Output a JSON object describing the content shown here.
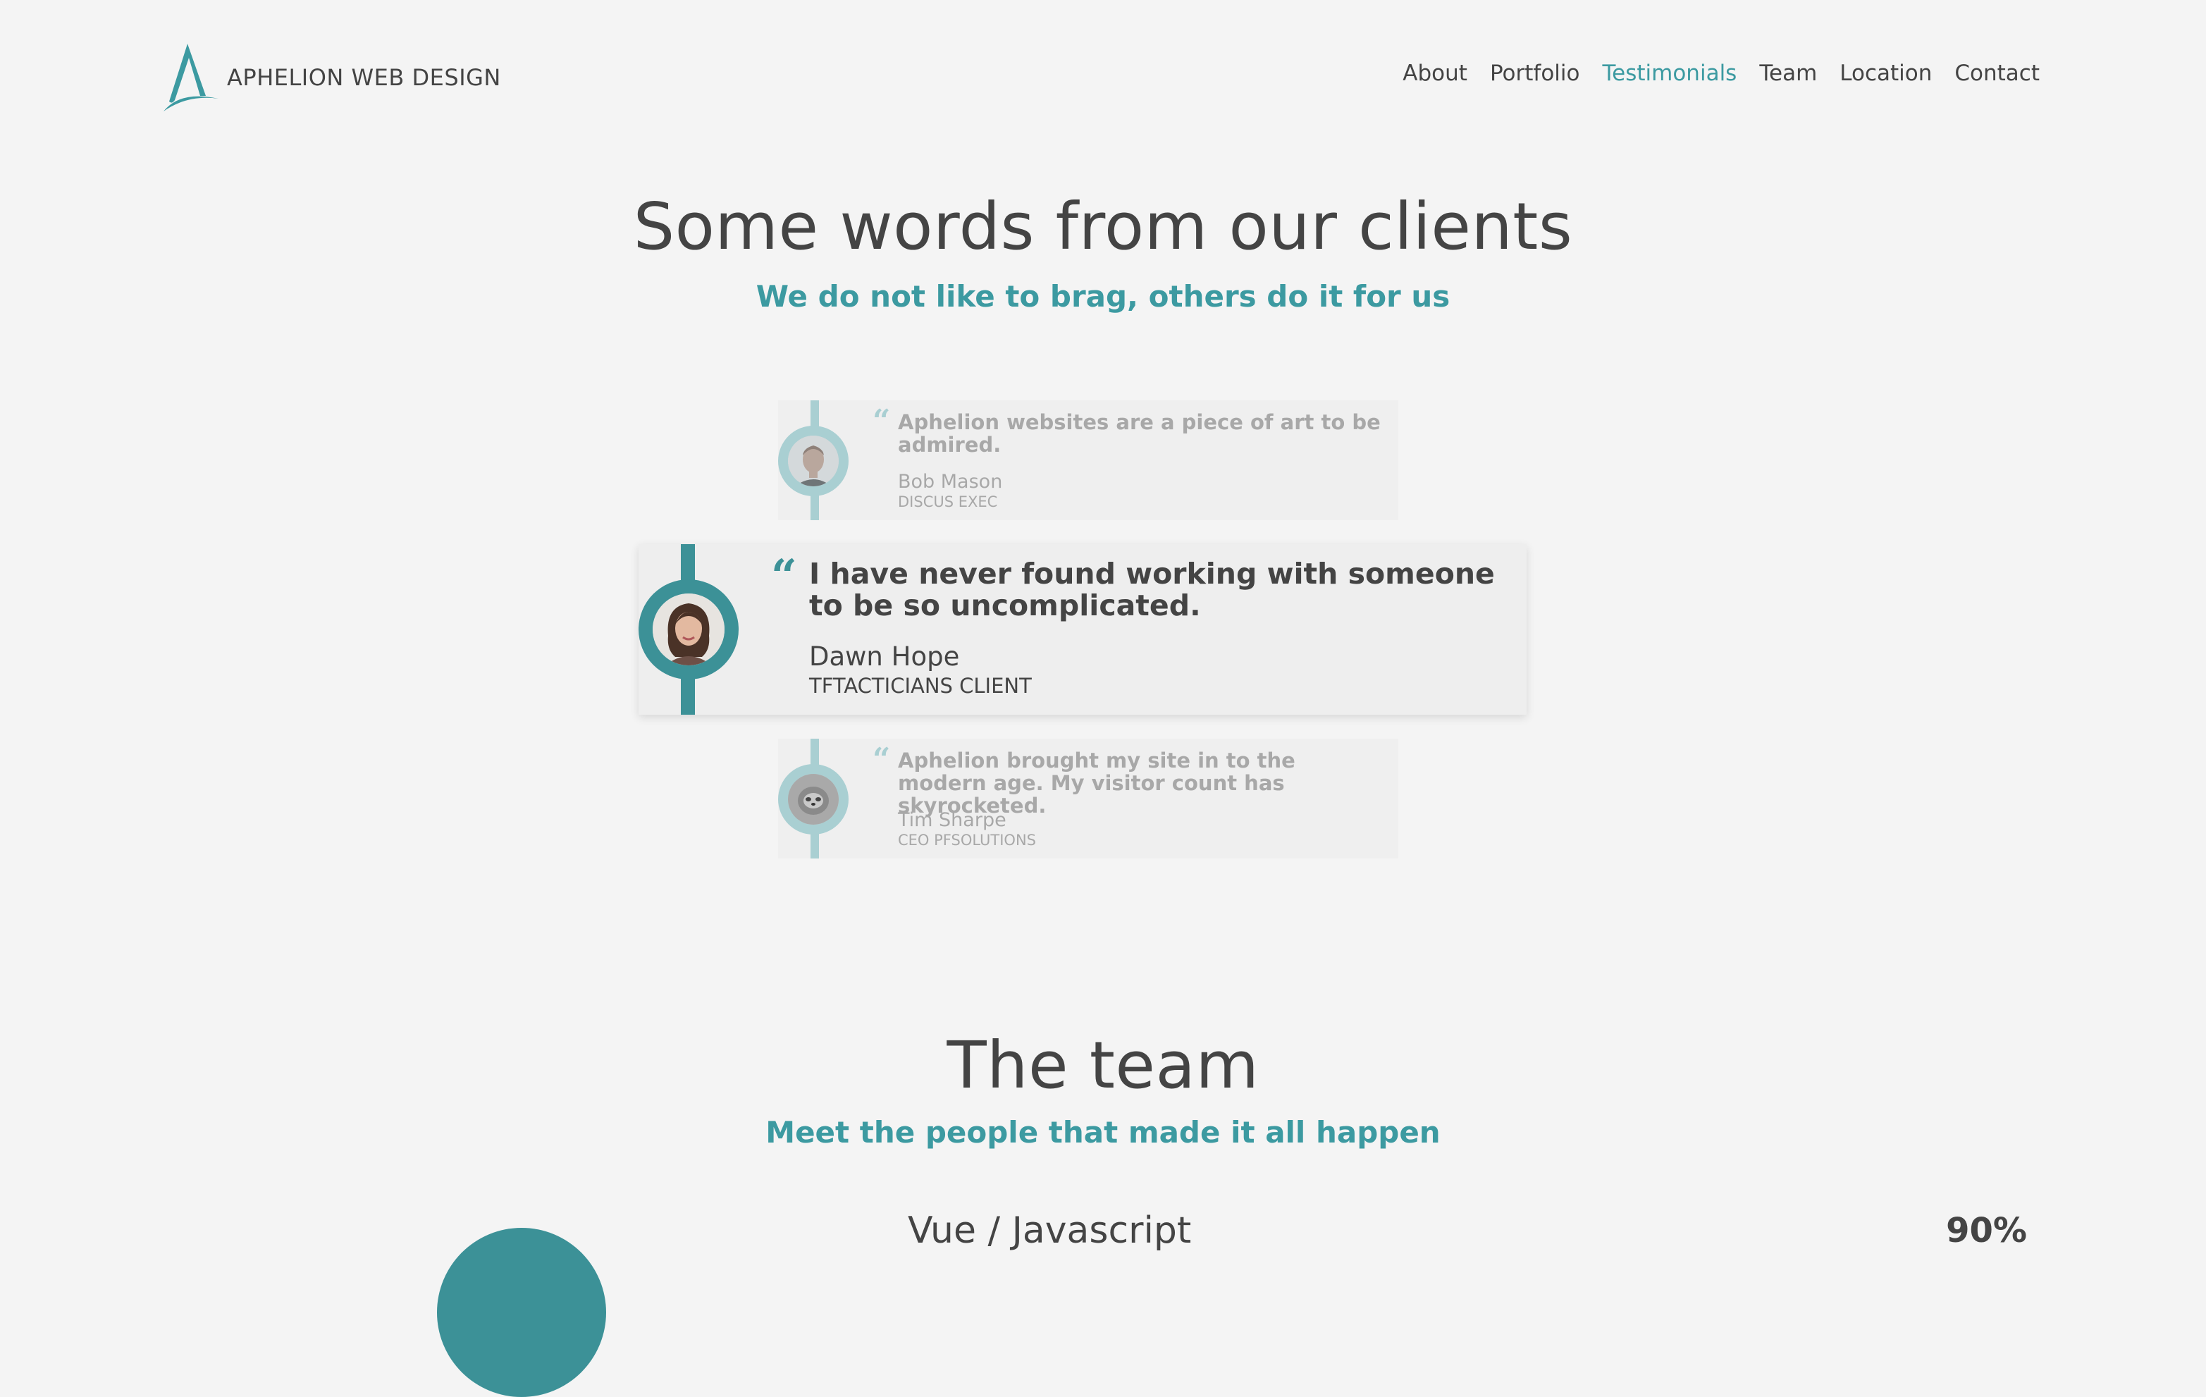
{
  "header": {
    "brand": "APHELION WEB DESIGN",
    "nav": [
      {
        "label": "About",
        "active": false
      },
      {
        "label": "Portfolio",
        "active": false
      },
      {
        "label": "Testimonials",
        "active": true
      },
      {
        "label": "Team",
        "active": false
      },
      {
        "label": "Location",
        "active": false
      },
      {
        "label": "Contact",
        "active": false
      }
    ]
  },
  "testimonials": {
    "title": "Some words from our clients",
    "subtitle": "We do not like to brag, others do it for us",
    "items": [
      {
        "quote": "Aphelion websites are a piece of art to be admired.",
        "author": "Bob Mason",
        "role": "DISCUS EXEC",
        "featured": false
      },
      {
        "quote": "I have never found working with someone to be so uncomplicated.",
        "author": "Dawn Hope",
        "role": "TFTACTICIANS CLIENT",
        "featured": true
      },
      {
        "quote": "Aphelion brought my site in to the modern age. My visitor count has skyrocketed.",
        "author": "Tim Sharpe",
        "role": "CEO PFSOLUTIONS",
        "featured": false
      }
    ],
    "quote_mark": "“"
  },
  "team": {
    "title": "The team",
    "subtitle": "Meet the people that made it all happen",
    "skill": {
      "name": "Vue / Javascript",
      "percent": "90%"
    }
  },
  "colors": {
    "accent": "#3c9aa1",
    "accent_dark": "#3c9197",
    "accent_light": "#a9cfd2",
    "background": "#f4f4f4",
    "text": "#444444"
  }
}
